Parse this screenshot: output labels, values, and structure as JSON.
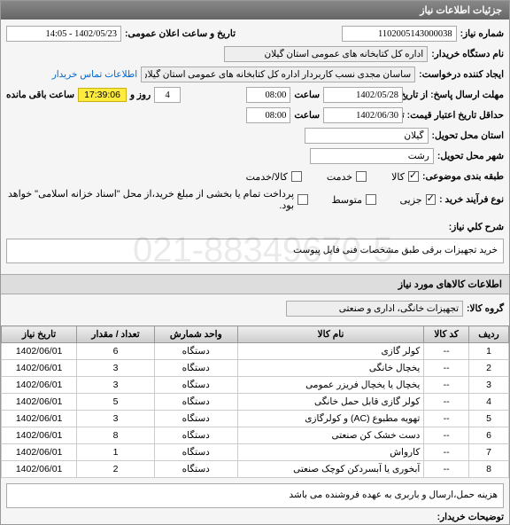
{
  "header": {
    "title": "جزئیات اطلاعات نیاز"
  },
  "fields": {
    "need_number_label": "شماره نیاز:",
    "need_number": "1102005143000038",
    "announce_label": "تاریخ و ساعت اعلان عمومی:",
    "announce_value": "1402/05/23 - 14:05",
    "buyer_org_label": "نام دستگاه خریدار:",
    "buyer_org": "اداره کل کتابخانه های عمومی استان گیلان",
    "requester_label": "ایجاد کننده درخواست:",
    "requester": "ساسان مجدی نسب کاربردار اداره کل کتابخانه های عمومی استان گیلان",
    "buyer_contact": "اطلاعات تماس خریدار",
    "deadline_from_label": "مهلت ارسال پاسخ: از تاریخ:",
    "deadline_from_date": "1402/05/28",
    "time_label": "ساعت",
    "deadline_from_time": "08:00",
    "day_label": "روز و",
    "days_left": "4",
    "countdown": "17:39:06",
    "remaining_label": "ساعت باقی مانده",
    "valid_until_label": "حداقل تاریخ اعتبار قیمت: تا تاریخ:",
    "valid_until_date": "1402/06/30",
    "valid_until_time": "08:00",
    "delivery_province_label": "استان محل تحویل:",
    "delivery_province": "گیلان",
    "delivery_city_label": "شهر محل تحویل:",
    "delivery_city": "رشت",
    "category_label": "طبقه بندی موضوعی:",
    "cat_goods": "کالا",
    "cat_service": "خدمت",
    "cat_goods_service": "کالا/خدمت",
    "purchase_type_label": "نوع فرآیند خرید :",
    "pt_small": "جزیی",
    "pt_medium": "متوسط",
    "pt_note": "پرداخت تمام یا بخشی از مبلغ خرید،از محل \"اسناد خزانه اسلامی\" خواهد بود.",
    "need_desc_label": "شرح کلي نیاز:",
    "need_desc": "خرید تجهیزات برقی طبق مشخصات فنی فایل پیوست"
  },
  "goods_section": {
    "title": "اطلاعات کالاهای مورد نیاز",
    "group_label": "گروه کالا:",
    "group_value": "تجهیزات خانگی، اداری و صنعتی"
  },
  "table": {
    "headers": {
      "row": "ردیف",
      "code": "کد کالا",
      "name": "نام کالا",
      "unit": "واحد شمارش",
      "qty": "تعداد / مقدار",
      "date": "تاریخ نیاز"
    },
    "rows": [
      {
        "r": "1",
        "code": "--",
        "name": "کولر گازی",
        "unit": "دستگاه",
        "qty": "6",
        "date": "1402/06/01"
      },
      {
        "r": "2",
        "code": "--",
        "name": "یخچال خانگی",
        "unit": "دستگاه",
        "qty": "3",
        "date": "1402/06/01"
      },
      {
        "r": "3",
        "code": "--",
        "name": "یخچال یا یخچال فریزر عمومی",
        "unit": "دستگاه",
        "qty": "3",
        "date": "1402/06/01"
      },
      {
        "r": "4",
        "code": "--",
        "name": "کولر گازی قابل حمل خانگی",
        "unit": "دستگاه",
        "qty": "5",
        "date": "1402/06/01"
      },
      {
        "r": "5",
        "code": "--",
        "name": "تهویه مطبوع (AC) و کولرگازی",
        "unit": "دستگاه",
        "qty": "3",
        "date": "1402/06/01"
      },
      {
        "r": "6",
        "code": "--",
        "name": "دست خشک کن صنعتی",
        "unit": "دستگاه",
        "qty": "8",
        "date": "1402/06/01"
      },
      {
        "r": "7",
        "code": "--",
        "name": "کارواش",
        "unit": "دستگاه",
        "qty": "1",
        "date": "1402/06/01"
      },
      {
        "r": "8",
        "code": "--",
        "name": "آبخوری یا آبسردکن کوچک صنعتی",
        "unit": "دستگاه",
        "qty": "2",
        "date": "1402/06/01"
      }
    ]
  },
  "buyer_notes": {
    "label": "توضیحات خریدار:",
    "text": "هزینه حمل،ارسال و باربری به عهده فروشنده می باشد"
  },
  "watermark": "021-88349670-5"
}
